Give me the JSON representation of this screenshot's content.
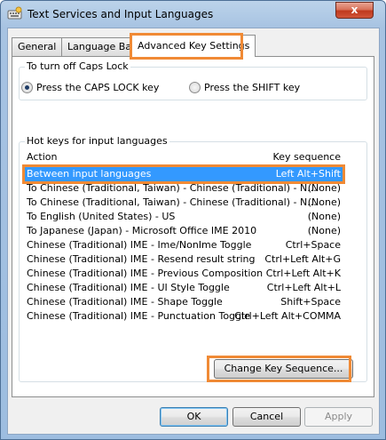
{
  "window": {
    "title": "Text Services and Input Languages",
    "close_label": "x",
    "icon": "keyboard-settings-icon"
  },
  "tabs": [
    {
      "label": "General",
      "active": false
    },
    {
      "label": "Language Bar",
      "active": false
    },
    {
      "label": "Advanced Key Settings",
      "active": true
    }
  ],
  "caps_lock": {
    "title": "To turn off Caps Lock",
    "options": [
      {
        "label": "Press the CAPS LOCK key",
        "checked": true
      },
      {
        "label": "Press the SHIFT key",
        "checked": false
      }
    ]
  },
  "hotkeys": {
    "title": "Hot keys for input languages",
    "columns": {
      "action": "Action",
      "sequence": "Key sequence"
    },
    "rows": [
      {
        "action": "Between input languages",
        "sequence": "Left Alt+Shift",
        "selected": true
      },
      {
        "action": "To Chinese (Traditional, Taiwan) - Chinese (Traditional) - N...",
        "sequence": "(None)"
      },
      {
        "action": "To Chinese (Traditional, Taiwan) - Chinese (Traditional) - N...",
        "sequence": "(None)"
      },
      {
        "action": "To English (United States) - US",
        "sequence": "(None)"
      },
      {
        "action": "To Japanese (Japan) - Microsoft Office IME 2010",
        "sequence": "(None)"
      },
      {
        "action": "Chinese (Traditional) IME - Ime/NonIme Toggle",
        "sequence": "Ctrl+Space"
      },
      {
        "action": "Chinese (Traditional) IME - Resend result string",
        "sequence": "Ctrl+Left Alt+G"
      },
      {
        "action": "Chinese (Traditional) IME - Previous Composition",
        "sequence": "Ctrl+Left Alt+K"
      },
      {
        "action": "Chinese (Traditional) IME - UI Style Toggle",
        "sequence": "Ctrl+Left Alt+L"
      },
      {
        "action": "Chinese (Traditional) IME - Shape Toggle",
        "sequence": "Shift+Space"
      },
      {
        "action": "Chinese (Traditional) IME - Punctuation Toggle",
        "sequence": "Ctrl+Left Alt+COMMA"
      }
    ],
    "change_button": "Change Key Sequence..."
  },
  "footer": {
    "ok": "OK",
    "cancel": "Cancel",
    "apply": "Apply",
    "apply_enabled": false
  },
  "colors": {
    "highlight_outline": "#f08a35",
    "selection": "#3399ff",
    "title_gradient": "#a7c3e2"
  }
}
